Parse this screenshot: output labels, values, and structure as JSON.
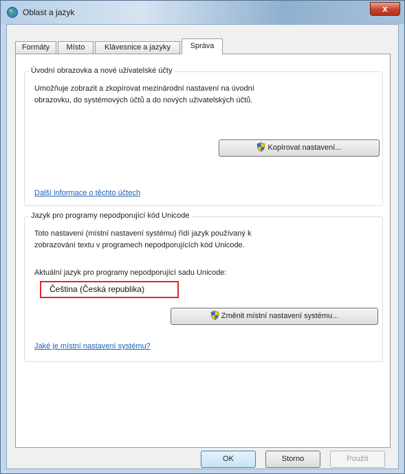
{
  "window": {
    "title": "Oblast a jazyk",
    "close_label": "x"
  },
  "tabs": [
    {
      "label": "Formáty"
    },
    {
      "label": "Místo"
    },
    {
      "label": "Klávesnice a jazyky"
    },
    {
      "label": "Správa"
    }
  ],
  "welcome_group": {
    "title": "Úvodní obrazovka a nové uživatelské účty",
    "description_line1": "Umožňuje zobrazit a zkopírovat mezinárodní nastavení na úvodní",
    "description_line2": "obrazovku, do systémových účtů a do nových uživatelských účtů.",
    "copy_button": "Kopírovat nastavení...",
    "more_info_link": "Další informace o těchto účtech"
  },
  "unicode_group": {
    "title": "Jazyk pro programy nepodporující kód Unicode",
    "description_line1": "Toto nastavení (místní nastavení systému) řídí jazyk používaný k",
    "description_line2": "zobrazování textu v programech nepodporujících kód Unicode.",
    "current_label": "Aktuální jazyk pro programy nepodporující sadu Unicode:",
    "current_value": "Čeština (Česká republika)",
    "change_button": "Změnit místní nastavení systému...",
    "what_is_link": "Jaké je místní nastavení systému?"
  },
  "footer": {
    "ok": "OK",
    "cancel": "Storno",
    "apply": "Použít"
  },
  "colors": {
    "highlight": "#e0262b",
    "link": "#1a5fb4"
  }
}
